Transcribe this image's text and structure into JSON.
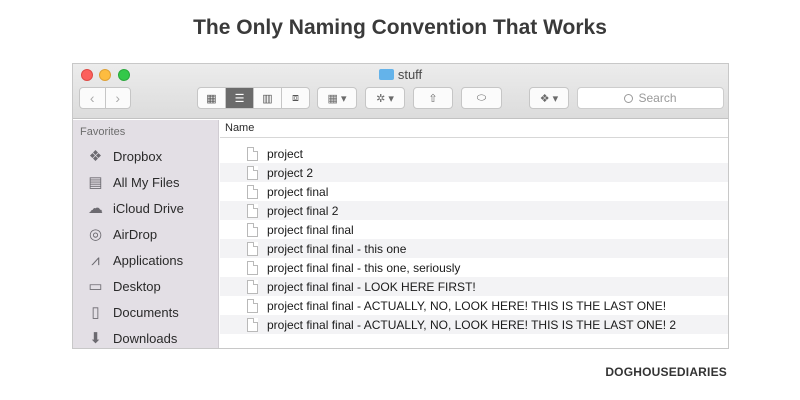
{
  "comic": {
    "title": "The Only Naming Convention That Works",
    "credit": "DOGHOUSEDIARIES"
  },
  "window": {
    "title": "stuff",
    "title_icon": "folder-icon"
  },
  "toolbar": {
    "nav": {
      "back": "‹",
      "forward": "›"
    },
    "view_modes": [
      {
        "icon": "icon-view-icon",
        "glyph": "▦"
      },
      {
        "icon": "list-view-icon",
        "glyph": "☰",
        "active": true
      },
      {
        "icon": "column-view-icon",
        "glyph": "▥"
      },
      {
        "icon": "cover-flow-icon",
        "glyph": "⧈"
      }
    ],
    "arrange": "▦ ▾",
    "action": "✲ ▾",
    "share": "⇧",
    "tags": "⬭",
    "dropbox": "❖ ▾",
    "search_placeholder": "Search"
  },
  "sidebar": {
    "heading": "Favorites",
    "items": [
      {
        "label": "Dropbox",
        "icon": "dropbox-icon"
      },
      {
        "label": "All My Files",
        "icon": "all-my-files-icon"
      },
      {
        "label": "iCloud Drive",
        "icon": "cloud-icon"
      },
      {
        "label": "AirDrop",
        "icon": "airdrop-icon"
      },
      {
        "label": "Applications",
        "icon": "applications-icon"
      },
      {
        "label": "Desktop",
        "icon": "desktop-icon"
      },
      {
        "label": "Documents",
        "icon": "documents-icon"
      },
      {
        "label": "Downloads",
        "icon": "downloads-icon"
      }
    ]
  },
  "file_list": {
    "column_name": "Name",
    "files": [
      "project",
      "project 2",
      "project final",
      "project final 2",
      "project final final",
      "project final final - this one",
      "project final final - this one, seriously",
      "project final final - LOOK HERE FIRST!",
      "project final final - ACTUALLY, NO, LOOK HERE! THIS IS THE LAST ONE!",
      "project final final - ACTUALLY, NO, LOOK HERE! THIS IS THE LAST ONE! 2"
    ]
  }
}
